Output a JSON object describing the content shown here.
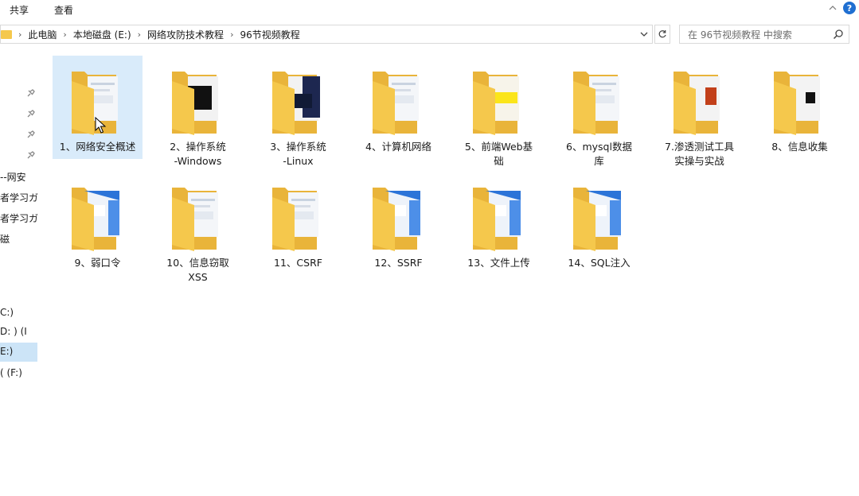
{
  "ribbon": {
    "tab_share": "共享",
    "tab_view": "查看"
  },
  "address": {
    "crumbs": [
      "此电脑",
      "本地磁盘 (E:)",
      "网络攻防技术教程",
      "96节视频教程"
    ]
  },
  "search": {
    "placeholder": "在 96节视频教程 中搜索"
  },
  "nav": {
    "items": [
      "--网安",
      "者学习ガ",
      "者学习ガ",
      "磁",
      "C:)",
      "D: ) (I",
      "E:)",
      "( (F:)"
    ]
  },
  "folders": [
    {
      "line1": "1、网络安全概述",
      "line2": "",
      "preview": "doc"
    },
    {
      "line1": "2、操作系统",
      "line2": "-Windows",
      "preview": "dark"
    },
    {
      "line1": "3、操作系统",
      "line2": "-Linux",
      "preview": "navy"
    },
    {
      "line1": "4、计算机网络",
      "line2": "",
      "preview": "doc"
    },
    {
      "line1": "5、前端Web基",
      "line2": "础",
      "preview": "yellow"
    },
    {
      "line1": "6、mysql数据",
      "line2": "库",
      "preview": "doc"
    },
    {
      "line1": "7.渗透测试工具",
      "line2": "实操与实战",
      "preview": "red"
    },
    {
      "line1": "8、信息收集",
      "line2": "",
      "preview": "black"
    },
    {
      "line1": "9、弱口令",
      "line2": "",
      "preview": "blue"
    },
    {
      "line1": "10、信息窃取",
      "line2": "XSS",
      "preview": "doc"
    },
    {
      "line1": "11、CSRF",
      "line2": "",
      "preview": "doc"
    },
    {
      "line1": "12、SSRF",
      "line2": "",
      "preview": "blue"
    },
    {
      "line1": "13、文件上传",
      "line2": "",
      "preview": "blue"
    },
    {
      "line1": "14、SQL注入",
      "line2": "",
      "preview": "blue"
    }
  ],
  "colors": {
    "folder": "#f5c84c",
    "folder_dark": "#e9b43a",
    "selection": "#d9ebfa",
    "accent": "#1f6fd1"
  }
}
